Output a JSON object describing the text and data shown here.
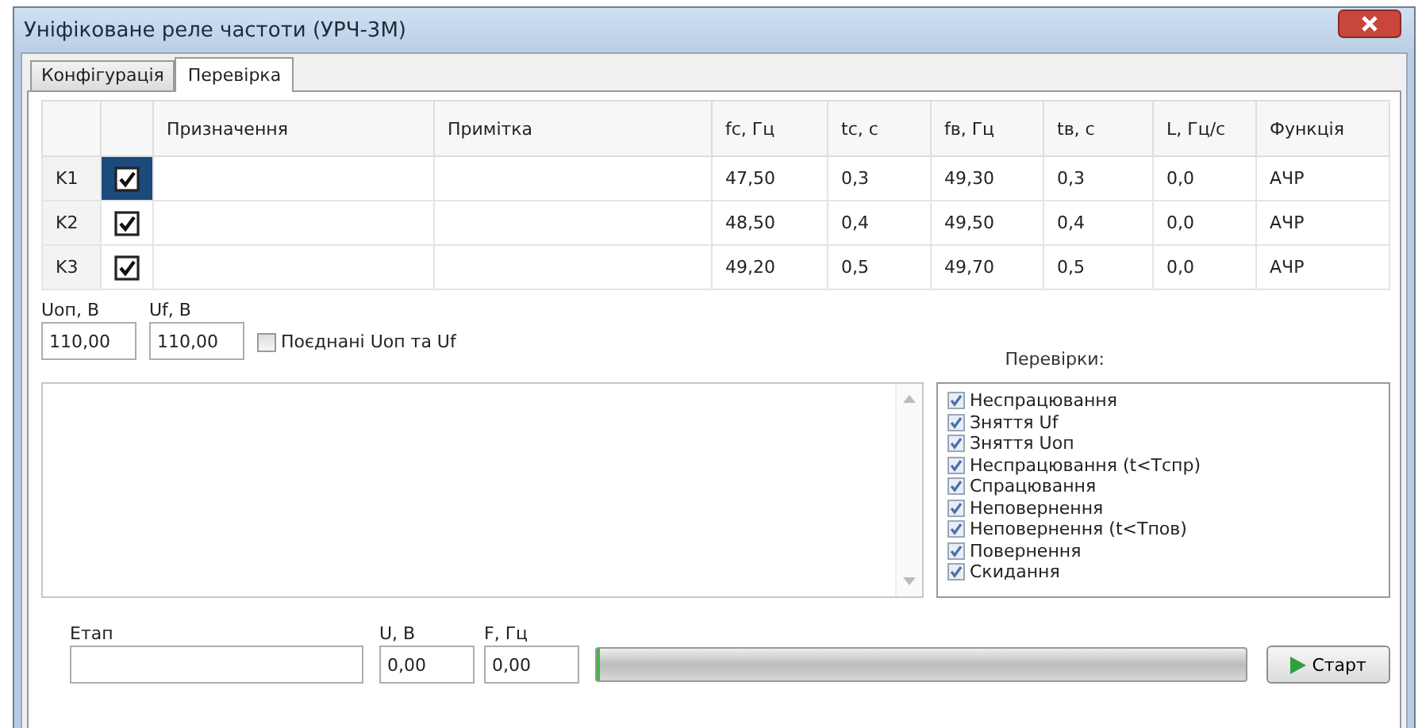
{
  "window": {
    "title": "Уніфіковане реле частоти (УРЧ-3М)"
  },
  "tabs": [
    {
      "label": "Конфігурація",
      "selected": false
    },
    {
      "label": "Перевірка",
      "selected": true
    }
  ],
  "table": {
    "columns": [
      "Призначення",
      "Примітка",
      "fc, Гц",
      "tc, c",
      "fв, Гц",
      "tв, c",
      "L, Гц/c",
      "Функція"
    ],
    "rows": [
      {
        "label": "K1",
        "checked": true,
        "selected": true,
        "cells": [
          "",
          "",
          "47,50",
          "0,3",
          "49,30",
          "0,3",
          "0,0",
          "АЧР"
        ]
      },
      {
        "label": "K2",
        "checked": true,
        "selected": false,
        "cells": [
          "",
          "",
          "48,50",
          "0,4",
          "49,50",
          "0,4",
          "0,0",
          "АЧР"
        ]
      },
      {
        "label": "K3",
        "checked": true,
        "selected": false,
        "cells": [
          "",
          "",
          "49,20",
          "0,5",
          "49,70",
          "0,5",
          "0,0",
          "АЧР"
        ]
      }
    ]
  },
  "voltages": [
    {
      "label": "Uоп, В",
      "value": "110,00"
    },
    {
      "label": "Uf, В",
      "value": "110,00"
    }
  ],
  "combined": {
    "label": "Поєднані Uоп та Uf",
    "checked": false
  },
  "checks": {
    "title": "Перевірки:",
    "items": [
      {
        "label": "Неспрацювання",
        "checked": true
      },
      {
        "label": "Зняття Uf",
        "checked": true
      },
      {
        "label": "Зняття Uоп",
        "checked": true
      },
      {
        "label": "Неспрацювання (t<Tспр)",
        "checked": true
      },
      {
        "label": "Спрацювання",
        "checked": true
      },
      {
        "label": "Неповернення",
        "checked": true
      },
      {
        "label": "Неповернення (t<Tпов)",
        "checked": true
      },
      {
        "label": "Повернення",
        "checked": true
      },
      {
        "label": "Скидання",
        "checked": true
      }
    ]
  },
  "bottom": {
    "stage_label": "Етап",
    "u_label": "U, В",
    "u_value": "0,00",
    "f_label": "F, Гц",
    "f_value": "0,00",
    "progress": {
      "level": 0.004
    },
    "start_button": "Старт"
  }
}
